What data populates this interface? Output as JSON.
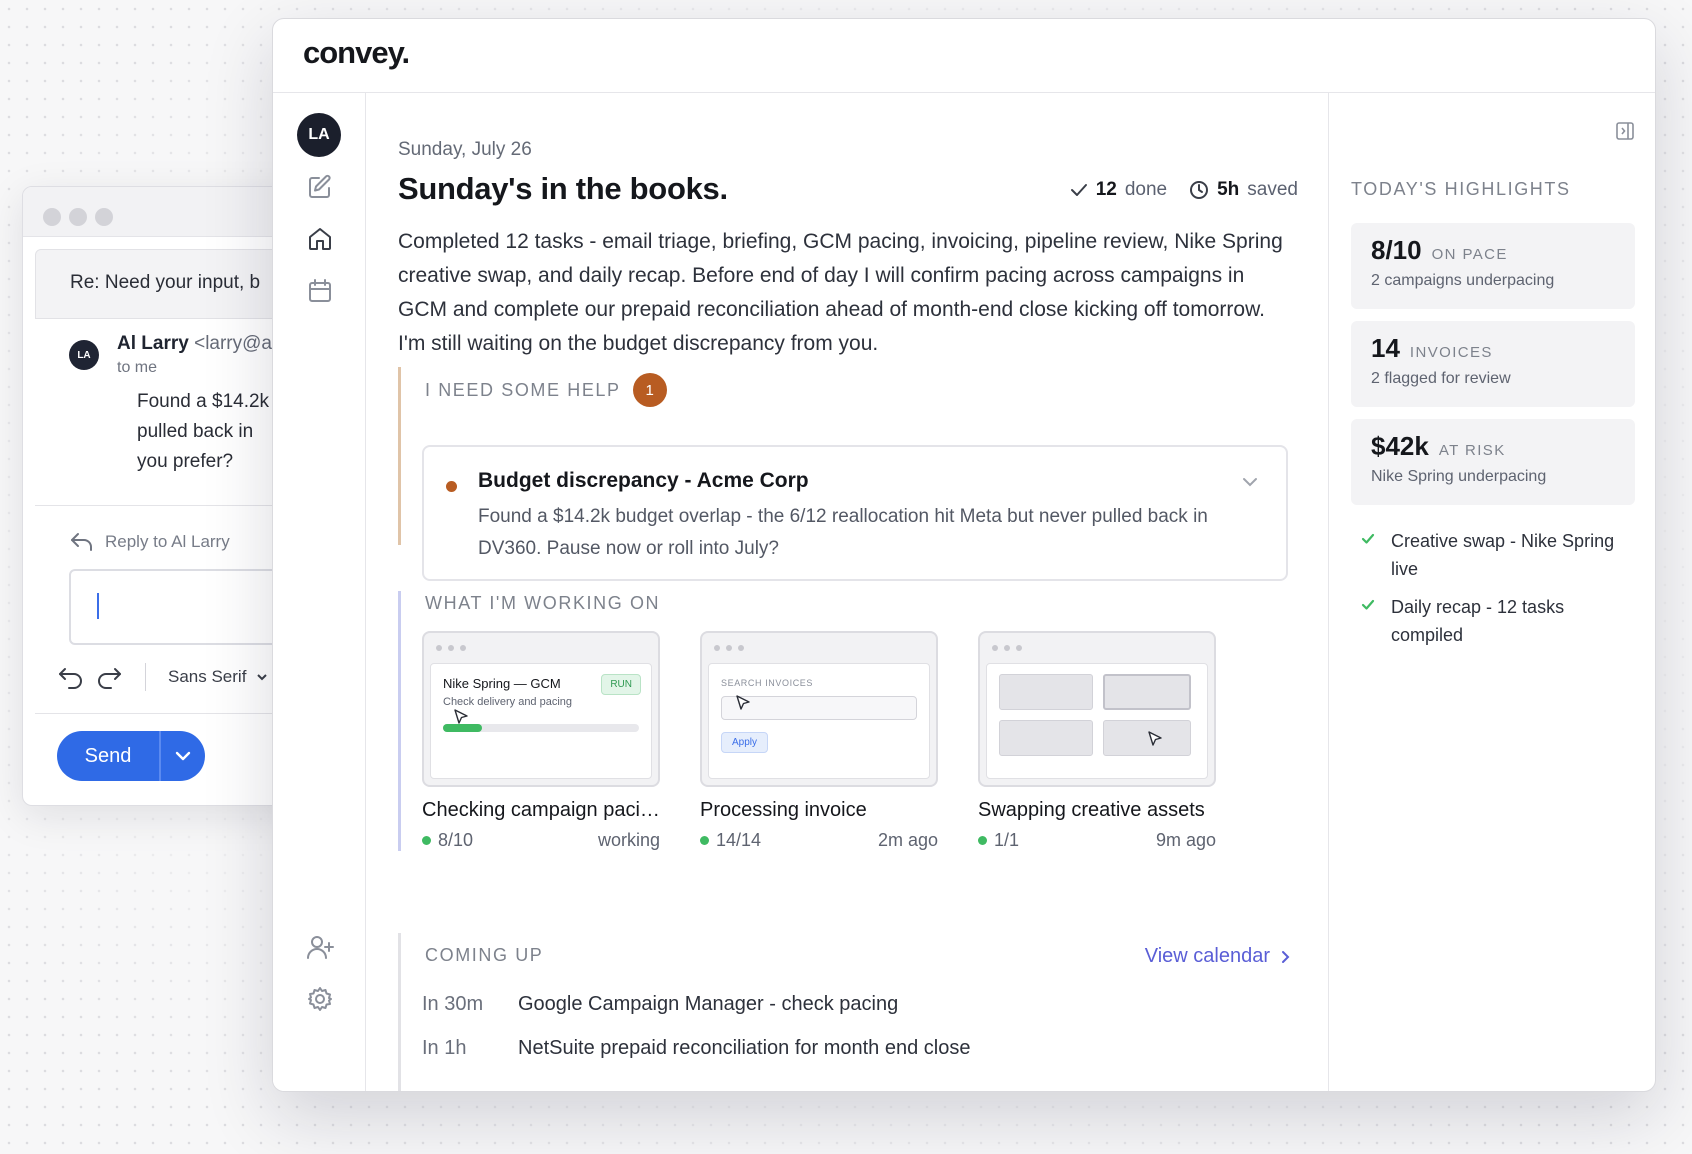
{
  "email": {
    "subject": "Re: Need your input, b",
    "avatar_initials": "LA",
    "sender_name": "Al Larry",
    "sender_email": "<larry@a",
    "recipient": "to me",
    "body_lines": [
      "Found a $14.2k",
      "pulled back in",
      "you prefer?"
    ],
    "reply_label": "Reply to Al Larry",
    "font_label": "Sans Serif",
    "send_label": "Send"
  },
  "app": {
    "logo": "convey.",
    "user_initials": "LA",
    "date": "Sunday, July 26",
    "title": "Sunday's in the books.",
    "done_count": "12",
    "done_label": "done",
    "saved_amount": "5h",
    "saved_label": "saved",
    "summary": "Completed 12 tasks - email triage, briefing, GCM pacing, invoicing, pipeline review, Nike Spring creative swap, and daily recap. Before end of day I will confirm pacing across campaigns in GCM and complete our prepaid reconciliation ahead of month-end close kicking off tomorrow. I'm still waiting on the budget discrepancy from you.",
    "help": {
      "heading": "I NEED SOME HELP",
      "count": "1",
      "item_title": "Budget discrepancy - Acme Corp",
      "item_body": "Found a $14.2k budget overlap - the 6/12 reallocation hit Meta but never pulled back in DV360. Pause now or roll into July?"
    },
    "working": {
      "heading": "WHAT I'M WORKING ON",
      "tasks": [
        {
          "name": "Checking campaign pacing",
          "progress": "8/10",
          "status": "working",
          "thumb_title": "Nike Spring — GCM",
          "thumb_sub": "Check delivery and pacing",
          "thumb_badge": "RUN",
          "thumb_fill": 0.2
        },
        {
          "name": "Processing invoice",
          "progress": "14/14",
          "status": "2m ago",
          "thumb_title": "SEARCH INVOICES",
          "thumb_btn": "Apply"
        },
        {
          "name": "Swapping creative assets",
          "progress": "1/1",
          "status": "9m ago"
        }
      ]
    },
    "coming_up": {
      "heading": "COMING UP",
      "link": "View calendar",
      "events": [
        {
          "when": "In 30m",
          "what": "Google Campaign Manager - check pacing"
        },
        {
          "when": "In 1h",
          "what": "NetSuite prepaid reconciliation for month end close"
        }
      ]
    },
    "highlights": {
      "heading": "TODAY'S HIGHLIGHTS",
      "cards": [
        {
          "value": "8/10",
          "unit": "ON PACE",
          "sub": "2 campaigns underpacing"
        },
        {
          "value": "14",
          "unit": "INVOICES",
          "sub": "2 flagged for review"
        },
        {
          "value": "$42k",
          "unit": "AT RISK",
          "sub": "Nike Spring underpacing"
        }
      ],
      "checks": [
        "Creative swap - Nike Spring live",
        "Daily recap - 12 tasks compiled"
      ]
    }
  },
  "colors": {
    "accent": "#2f6ae6",
    "alert": "#b85c22",
    "success": "#3fba62",
    "link": "#5a5ed6"
  }
}
